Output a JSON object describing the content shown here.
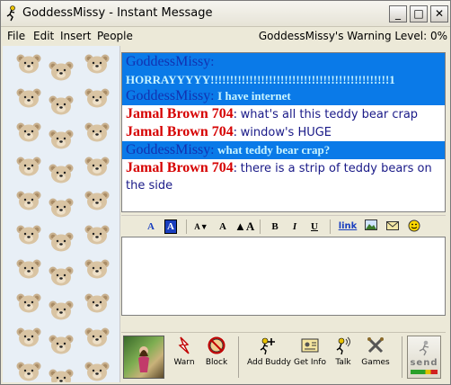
{
  "window": {
    "title": "GoddessMissy - Instant Message",
    "minimize_glyph": "_",
    "maximize_glyph": "□",
    "close_glyph": "✕"
  },
  "menu": {
    "items": [
      "File",
      "Edit",
      "Insert",
      "People"
    ],
    "warning_level": "GoddessMissy's Warning Level: 0%"
  },
  "chat": {
    "messages": [
      {
        "sender": "GoddessMissy",
        "text": "HORRAYYYYY!!!!!!!!!!!!!!!!!!!!!!!!!!!!!!!!!!!!!!!!!!!!!!1",
        "selected": true
      },
      {
        "sender": "GoddessMissy",
        "text": "I have internet",
        "selected": true
      },
      {
        "sender": "Jamal Brown 704",
        "text": "what's all this teddy bear crap",
        "selected": false
      },
      {
        "sender": "Jamal Brown 704",
        "text": "window's HUGE",
        "selected": false
      },
      {
        "sender": "GoddessMissy",
        "text": "what teddy bear crap?",
        "selected": true
      },
      {
        "sender": "Jamal Brown 704",
        "text": "there is a strip of teddy bears on the side",
        "selected": false
      }
    ]
  },
  "format_toolbar": {
    "text_color": "A",
    "bg_color": "A",
    "smaller_font": "A▼",
    "normal_font": "A",
    "larger_font": "▲A",
    "bold": "B",
    "italic": "I",
    "underline": "U",
    "link": "link"
  },
  "bottom_toolbar": {
    "warn": "Warn",
    "block": "Block",
    "add_buddy": "Add Buddy",
    "get_info": "Get Info",
    "talk": "Talk",
    "games": "Games",
    "send": "send"
  },
  "colors": {
    "selection": "#0a7ae8",
    "goddess_name": "#1232b0",
    "jamal_name": "#d60000",
    "jamal_text": "#1a1a88",
    "goddess_text": "#c8f4ff"
  }
}
